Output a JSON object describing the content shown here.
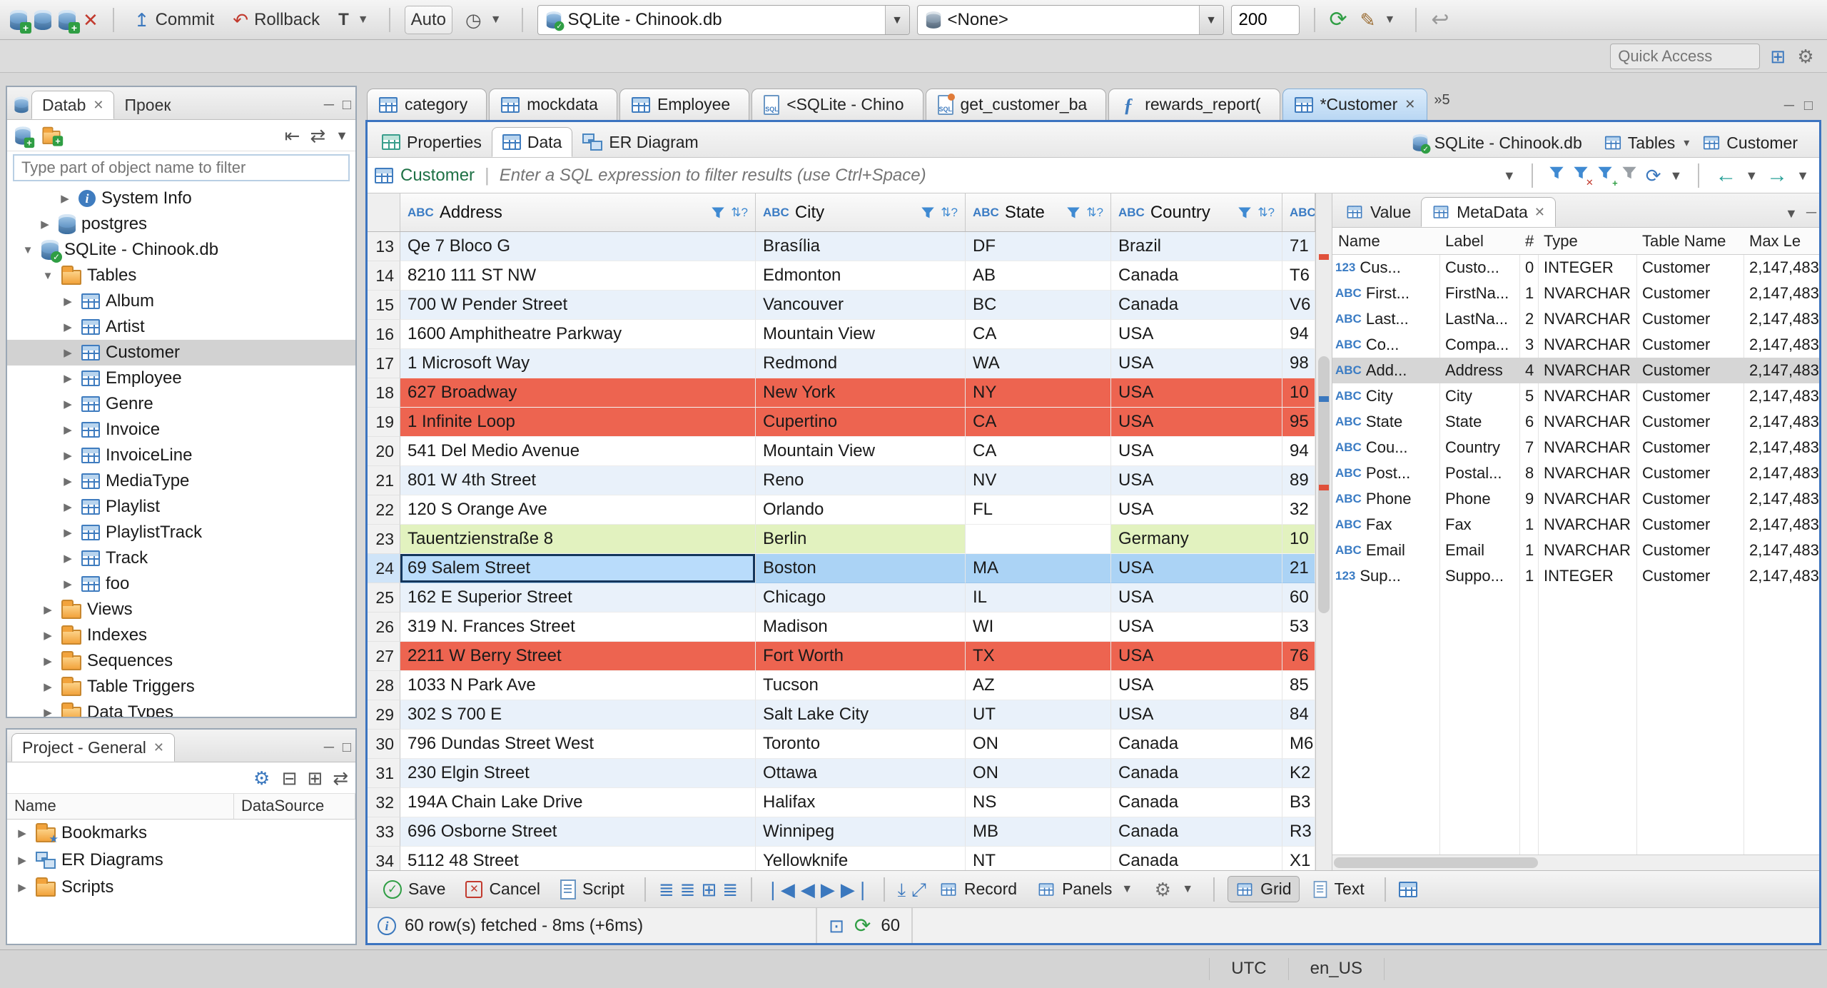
{
  "toolbar": {
    "commit": "Commit",
    "rollback": "Rollback",
    "auto": "Auto",
    "db_combo": "SQLite - Chinook.db",
    "schema_combo": "<None>",
    "fetch_size": "200"
  },
  "quick_access": {
    "placeholder": "Quick Access"
  },
  "navigator": {
    "tab_db": "Datab",
    "tab_db_close": "✕",
    "tab_project": "Проек",
    "filter_placeholder": "Type part of object name to filter",
    "tree": [
      {
        "label": "System Info",
        "indent": 62,
        "arrow": "▶",
        "icon": "ic-info"
      },
      {
        "label": "postgres",
        "indent": 34,
        "arrow": "▶",
        "icon": "ic-db"
      },
      {
        "label": "SQLite - Chinook.db",
        "indent": 10,
        "arrow": "▼",
        "icon": "ic-db ic-dbc"
      },
      {
        "label": "Tables",
        "indent": 38,
        "arrow": "▼",
        "icon": "ic-folder"
      },
      {
        "label": "Album",
        "indent": 66,
        "arrow": "▶",
        "icon": "ic-table"
      },
      {
        "label": "Artist",
        "indent": 66,
        "arrow": "▶",
        "icon": "ic-table"
      },
      {
        "label": "Customer",
        "indent": 66,
        "arrow": "▶",
        "icon": "ic-table",
        "cls": "selected"
      },
      {
        "label": "Employee",
        "indent": 66,
        "arrow": "▶",
        "icon": "ic-table"
      },
      {
        "label": "Genre",
        "indent": 66,
        "arrow": "▶",
        "icon": "ic-table"
      },
      {
        "label": "Invoice",
        "indent": 66,
        "arrow": "▶",
        "icon": "ic-table"
      },
      {
        "label": "InvoiceLine",
        "indent": 66,
        "arrow": "▶",
        "icon": "ic-table"
      },
      {
        "label": "MediaType",
        "indent": 66,
        "arrow": "▶",
        "icon": "ic-table"
      },
      {
        "label": "Playlist",
        "indent": 66,
        "arrow": "▶",
        "icon": "ic-table"
      },
      {
        "label": "PlaylistTrack",
        "indent": 66,
        "arrow": "▶",
        "icon": "ic-table"
      },
      {
        "label": "Track",
        "indent": 66,
        "arrow": "▶",
        "icon": "ic-table"
      },
      {
        "label": "foo",
        "indent": 66,
        "arrow": "▶",
        "icon": "ic-table"
      },
      {
        "label": "Views",
        "indent": 38,
        "arrow": "▶",
        "icon": "ic-folder"
      },
      {
        "label": "Indexes",
        "indent": 38,
        "arrow": "▶",
        "icon": "ic-folder"
      },
      {
        "label": "Sequences",
        "indent": 38,
        "arrow": "▶",
        "icon": "ic-folder"
      },
      {
        "label": "Table Triggers",
        "indent": 38,
        "arrow": "▶",
        "icon": "ic-folder"
      },
      {
        "label": "Data Types",
        "indent": 38,
        "arrow": "▶",
        "icon": "ic-folder"
      }
    ]
  },
  "project": {
    "title": "Project - General",
    "title_close": "✕",
    "col_name": "Name",
    "col_datasource": "DataSource",
    "items": [
      {
        "label": "Bookmarks",
        "icon": "ic-folder ic-star"
      },
      {
        "label": "ER Diagrams",
        "icon": "ic-er"
      },
      {
        "label": "Scripts",
        "icon": "ic-folder"
      }
    ]
  },
  "editor": {
    "tabs": [
      {
        "label": "category",
        "icon": "ic-table"
      },
      {
        "label": "mockdata",
        "icon": "ic-table"
      },
      {
        "label": "Employee",
        "icon": "ic-table"
      },
      {
        "label": "<SQLite - Chino",
        "icon": "ic-sql"
      },
      {
        "label": "get_customer_ba",
        "icon": "ic-sql warn"
      },
      {
        "label": "rewards_report(",
        "icon": "ic-func"
      },
      {
        "label": "*Customer",
        "icon": "ic-table",
        "cls": "active",
        "close": "✕"
      }
    ],
    "overflow": "»5"
  },
  "result": {
    "tabs": [
      {
        "label": "Properties",
        "icon": "ic-table teal"
      },
      {
        "label": "Data",
        "icon": "ic-table",
        "cls": "active"
      },
      {
        "label": "ER Diagram",
        "icon": "ic-er"
      }
    ],
    "breadcrumb": [
      {
        "label": "SQLite - Chinook.db",
        "icon": "ic-db ic-dbc"
      },
      {
        "label": "Tables",
        "icon": "ic-table",
        "caret": "▾"
      },
      {
        "label": "Customer",
        "icon": "ic-table"
      }
    ]
  },
  "filterbar": {
    "table": "Customer",
    "placeholder": "Enter a SQL expression to filter results (use Ctrl+Space)"
  },
  "grid": {
    "columns": [
      {
        "label": "Address",
        "wcls": "w-addr"
      },
      {
        "label": "City",
        "wcls": "w-city"
      },
      {
        "label": "State",
        "wcls": "w-state"
      },
      {
        "label": "Country",
        "wcls": "w-country"
      },
      {
        "label": "",
        "wcls": "w-extra cut"
      }
    ],
    "rows": [
      {
        "n": "13",
        "addr": "Qe 7 Bloco G",
        "city": "Brasília",
        "state": "DF",
        "country": "Brazil",
        "extra": "71",
        "cls": "alt"
      },
      {
        "n": "14",
        "addr": "8210 111 ST NW",
        "city": "Edmonton",
        "state": "AB",
        "country": "Canada",
        "extra": "T6",
        "cls": ""
      },
      {
        "n": "15",
        "addr": "700 W Pender Street",
        "city": "Vancouver",
        "state": "BC",
        "country": "Canada",
        "extra": "V6",
        "cls": "alt"
      },
      {
        "n": "16",
        "addr": "1600 Amphitheatre Parkway",
        "city": "Mountain View",
        "state": "CA",
        "country": "USA",
        "extra": "94",
        "cls": ""
      },
      {
        "n": "17",
        "addr": "1 Microsoft Way",
        "city": "Redmond",
        "state": "WA",
        "country": "USA",
        "extra": "98",
        "cls": "alt"
      },
      {
        "n": "18",
        "addr": "627 Broadway",
        "city": "New York",
        "state": "NY",
        "country": "USA",
        "extra": "10",
        "cls": "red"
      },
      {
        "n": "19",
        "addr": "1 Infinite Loop",
        "city": "Cupertino",
        "state": "CA",
        "country": "USA",
        "extra": "95",
        "cls": "red"
      },
      {
        "n": "20",
        "addr": "541 Del Medio Avenue",
        "city": "Mountain View",
        "state": "CA",
        "country": "USA",
        "extra": "94",
        "cls": ""
      },
      {
        "n": "21",
        "addr": "801 W 4th Street",
        "city": "Reno",
        "state": "NV",
        "country": "USA",
        "extra": "89",
        "cls": "alt"
      },
      {
        "n": "22",
        "addr": "120 S Orange Ave",
        "city": "Orlando",
        "state": "FL",
        "country": "USA",
        "extra": "32",
        "cls": ""
      },
      {
        "n": "23",
        "addr": "Tauentzienstraße 8",
        "city": "Berlin",
        "state": "",
        "country": "Germany",
        "extra": "10",
        "cls": "green",
        "state_cls": "plain"
      },
      {
        "n": "24",
        "addr": "69 Salem Street",
        "city": "Boston",
        "state": "MA",
        "country": "USA",
        "extra": "21",
        "cls": "sel",
        "addr_cls": "focus"
      },
      {
        "n": "25",
        "addr": "162 E Superior Street",
        "city": "Chicago",
        "state": "IL",
        "country": "USA",
        "extra": "60",
        "cls": "alt"
      },
      {
        "n": "26",
        "addr": "319 N. Frances Street",
        "city": "Madison",
        "state": "WI",
        "country": "USA",
        "extra": "53",
        "cls": ""
      },
      {
        "n": "27",
        "addr": "2211 W Berry Street",
        "city": "Fort Worth",
        "state": "TX",
        "country": "USA",
        "extra": "76",
        "cls": "red"
      },
      {
        "n": "28",
        "addr": "1033 N Park Ave",
        "city": "Tucson",
        "state": "AZ",
        "country": "USA",
        "extra": "85",
        "cls": ""
      },
      {
        "n": "29",
        "addr": "302 S 700 E",
        "city": "Salt Lake City",
        "state": "UT",
        "country": "USA",
        "extra": "84",
        "cls": "alt"
      },
      {
        "n": "30",
        "addr": "796 Dundas Street West",
        "city": "Toronto",
        "state": "ON",
        "country": "Canada",
        "extra": "M6",
        "cls": ""
      },
      {
        "n": "31",
        "addr": "230 Elgin Street",
        "city": "Ottawa",
        "state": "ON",
        "country": "Canada",
        "extra": "K2",
        "cls": "alt"
      },
      {
        "n": "32",
        "addr": "194A Chain Lake Drive",
        "city": "Halifax",
        "state": "NS",
        "country": "Canada",
        "extra": "B3",
        "cls": ""
      },
      {
        "n": "33",
        "addr": "696 Osborne Street",
        "city": "Winnipeg",
        "state": "MB",
        "country": "Canada",
        "extra": "R3",
        "cls": "alt"
      },
      {
        "n": "34",
        "addr": "5112 48 Street",
        "city": "Yellowknife",
        "state": "NT",
        "country": "Canada",
        "extra": "X1",
        "cls": ""
      }
    ]
  },
  "panel": {
    "tab_value": "Value",
    "tab_metadata": "MetaData",
    "tab_metadata_close": "✕",
    "columns": {
      "name": "Name",
      "label": "Label",
      "num": "#",
      "type": "Type",
      "table": "Table Name",
      "max": "Max Le"
    },
    "rows": [
      {
        "icon": "123",
        "name": "Cus...",
        "label": "Custo...",
        "num": "0",
        "type": "INTEGER",
        "table": "Customer",
        "max": "2,147,483",
        "cls": ""
      },
      {
        "icon": "ABC",
        "name": "First...",
        "label": "FirstNa...",
        "num": "1",
        "type": "NVARCHAR",
        "table": "Customer",
        "max": "2,147,483",
        "cls": ""
      },
      {
        "icon": "ABC",
        "name": "Last...",
        "label": "LastNa...",
        "num": "2",
        "type": "NVARCHAR",
        "table": "Customer",
        "max": "2,147,483",
        "cls": ""
      },
      {
        "icon": "ABC",
        "name": "Co...",
        "label": "Compa...",
        "num": "3",
        "type": "NVARCHAR",
        "table": "Customer",
        "max": "2,147,483",
        "cls": ""
      },
      {
        "icon": "ABC",
        "name": "Add...",
        "label": "Address",
        "num": "4",
        "type": "NVARCHAR",
        "table": "Customer",
        "max": "2,147,483",
        "cls": "selected"
      },
      {
        "icon": "ABC",
        "name": "City",
        "label": "City",
        "num": "5",
        "type": "NVARCHAR",
        "table": "Customer",
        "max": "2,147,483",
        "cls": ""
      },
      {
        "icon": "ABC",
        "name": "State",
        "label": "State",
        "num": "6",
        "type": "NVARCHAR",
        "table": "Customer",
        "max": "2,147,483",
        "cls": ""
      },
      {
        "icon": "ABC",
        "name": "Cou...",
        "label": "Country",
        "num": "7",
        "type": "NVARCHAR",
        "table": "Customer",
        "max": "2,147,483",
        "cls": ""
      },
      {
        "icon": "ABC",
        "name": "Post...",
        "label": "Postal...",
        "num": "8",
        "type": "NVARCHAR",
        "table": "Customer",
        "max": "2,147,483",
        "cls": ""
      },
      {
        "icon": "ABC",
        "name": "Phone",
        "label": "Phone",
        "num": "9",
        "type": "NVARCHAR",
        "table": "Customer",
        "max": "2,147,483",
        "cls": ""
      },
      {
        "icon": "ABC",
        "name": "Fax",
        "label": "Fax",
        "num": "1",
        "type": "NVARCHAR",
        "table": "Customer",
        "max": "2,147,483",
        "cls": ""
      },
      {
        "icon": "ABC",
        "name": "Email",
        "label": "Email",
        "num": "1",
        "type": "NVARCHAR",
        "table": "Customer",
        "max": "2,147,483",
        "cls": ""
      },
      {
        "icon": "123",
        "name": "Sup...",
        "label": "Suppo...",
        "num": "1",
        "type": "INTEGER",
        "table": "Customer",
        "max": "2,147,483",
        "cls": ""
      }
    ]
  },
  "bottom": {
    "save": "Save",
    "cancel": "Cancel",
    "script": "Script",
    "record": "Record",
    "panels": "Panels",
    "grid": "Grid",
    "text": "Text"
  },
  "status": {
    "fetched": "60 row(s) fetched - 8ms (+6ms)",
    "count": "60"
  },
  "statusbar": {
    "tz": "UTC",
    "locale": "en_US"
  }
}
